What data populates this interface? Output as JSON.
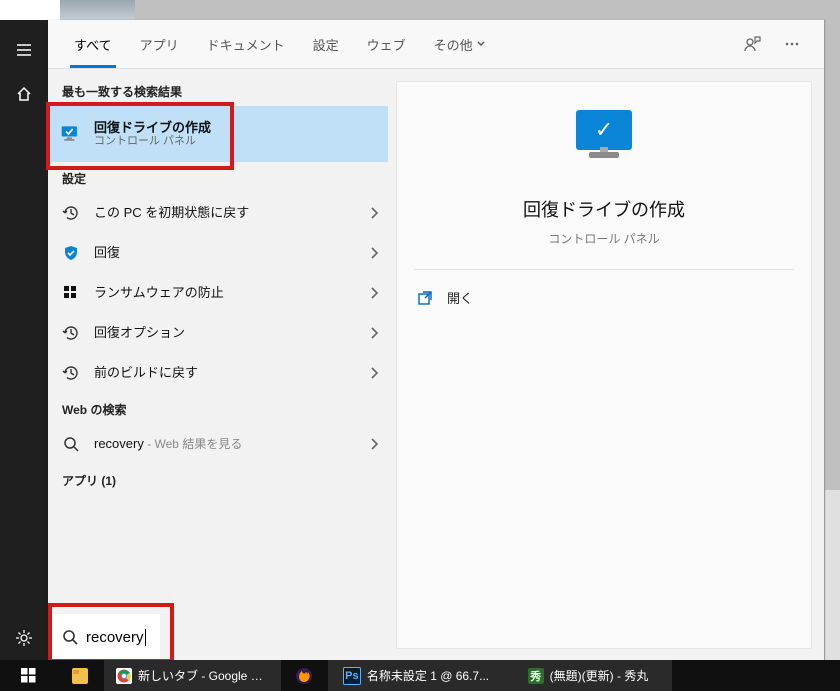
{
  "tabs": {
    "all": "すべて",
    "apps": "アプリ",
    "documents": "ドキュメント",
    "settings": "設定",
    "web": "ウェブ",
    "more": "その他"
  },
  "groups": {
    "best_match": "最も一致する検索結果",
    "settings": "設定",
    "web": "Web の検索",
    "apps_count": "アプリ (1)"
  },
  "best": {
    "title": "回復ドライブの作成",
    "sub": "コントロール パネル"
  },
  "settings_items": [
    {
      "icon": "history",
      "title": "この PC を初期状態に戻す"
    },
    {
      "icon": "shield",
      "title": "回復"
    },
    {
      "icon": "grid",
      "title": "ランサムウェアの防止"
    },
    {
      "icon": "history",
      "title": "回復オプション"
    },
    {
      "icon": "history",
      "title": "前のビルドに戻す"
    }
  ],
  "web_item": {
    "query": "recovery",
    "suffix": " - Web 結果を見る"
  },
  "preview": {
    "title": "回復ドライブの作成",
    "sub": "コントロール パネル",
    "open": "開く"
  },
  "search": {
    "query": "recovery"
  },
  "taskbar": {
    "chrome": "新しいタブ - Google Ch...",
    "ps": "名称未設定 1 @ 66.7...",
    "hm": "(無題)(更新) - 秀丸"
  }
}
